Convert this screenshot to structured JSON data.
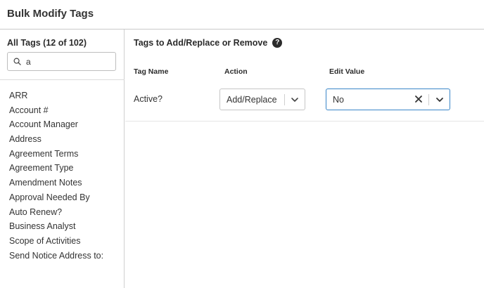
{
  "header": {
    "title": "Bulk Modify Tags"
  },
  "sidebar": {
    "heading": "All Tags (12 of 102)",
    "search": {
      "value": "a",
      "icon": "search-icon"
    },
    "tags": [
      "ARR",
      "Account #",
      "Account Manager",
      "Address",
      "Agreement Terms",
      "Agreement Type",
      "Amendment Notes",
      "Approval Needed By",
      "Auto Renew?",
      "Business Analyst",
      "Scope of Activities",
      "Send Notice Address to:"
    ]
  },
  "main": {
    "heading": "Tags to Add/Replace or Remove",
    "help_icon": "?",
    "columns": {
      "tag_name": "Tag Name",
      "action": "Action",
      "edit_value": "Edit Value"
    },
    "rows": [
      {
        "tag_name": "Active?",
        "action": "Add/Replace",
        "edit_value": "No"
      }
    ]
  },
  "colors": {
    "focus_border": "#3a86c8",
    "divider": "#c9c9c9"
  }
}
